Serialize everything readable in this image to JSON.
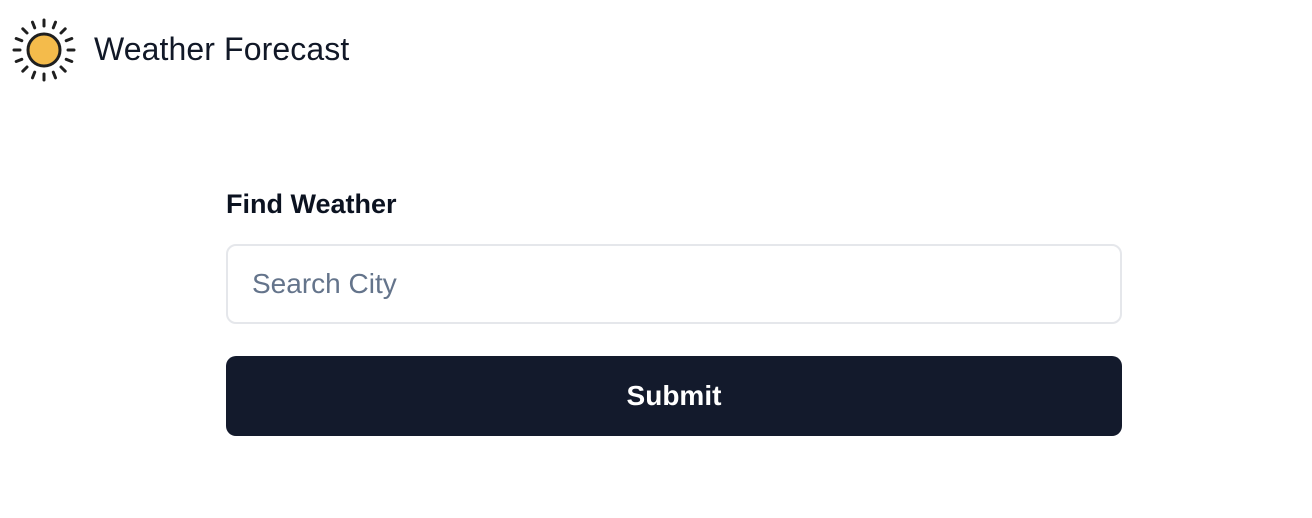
{
  "header": {
    "icon": "sun-icon",
    "title": "Weather Forecast"
  },
  "form": {
    "heading": "Find Weather",
    "search": {
      "placeholder": "Search City",
      "value": ""
    },
    "submit_label": "Submit"
  },
  "colors": {
    "sun_fill": "#f4bb4b",
    "sun_outline": "#1f1f1f",
    "button_bg": "#131a2c",
    "button_text": "#ffffff",
    "input_border": "#e5e7eb",
    "placeholder": "#64748b"
  }
}
